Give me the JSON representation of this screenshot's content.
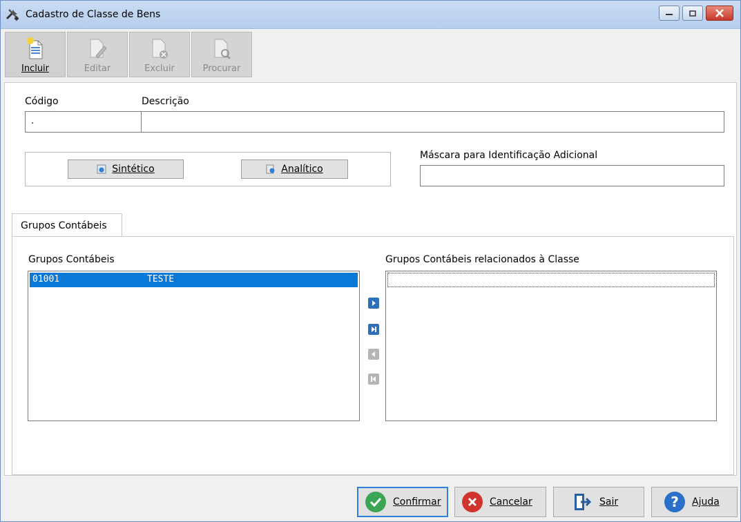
{
  "window": {
    "title": "Cadastro de Classe de Bens",
    "controls": [
      "minimize",
      "maximize",
      "close"
    ]
  },
  "toolbar": {
    "items": [
      {
        "label": "Incluir",
        "enabled": true,
        "icon": "document-new-icon"
      },
      {
        "label": "Editar",
        "enabled": false,
        "icon": "document-edit-icon"
      },
      {
        "label": "Excluir",
        "enabled": false,
        "icon": "document-delete-icon"
      },
      {
        "label": "Procurar",
        "enabled": false,
        "icon": "document-search-icon"
      }
    ]
  },
  "form": {
    "codigo_label": "Código",
    "codigo_value": ".",
    "descricao_label": "Descrição",
    "descricao_value": "",
    "sintetico_label": "Sintético",
    "analitico_label": "Analítico",
    "mascara_label": "Máscara para Identificação Adicional",
    "mascara_value": ""
  },
  "tabs": {
    "active": "Grupos Contábeis"
  },
  "groups": {
    "left_title": "Grupos Contábeis",
    "right_title": "Grupos Contábeis relacionados à Classe",
    "left_rows": [
      {
        "code": "01001",
        "name": "TESTE"
      }
    ],
    "right_rows": []
  },
  "transfer": {
    "buttons": [
      {
        "icon": "move-right-icon",
        "enabled": true
      },
      {
        "icon": "move-all-right-icon",
        "enabled": true
      },
      {
        "icon": "move-left-icon",
        "enabled": false
      },
      {
        "icon": "move-all-left-icon",
        "enabled": false
      }
    ]
  },
  "footer": {
    "confirmar": "Confirmar",
    "cancelar": "Cancelar",
    "sair": "Sair",
    "ajuda": "Ajuda"
  },
  "colors": {
    "selection": "#0a78d7",
    "confirm": "#3aa655",
    "cancel": "#d0342c",
    "help": "#2a6fc9",
    "transfer_enabled": "#2d6fb8",
    "transfer_disabled": "#b5b5b5"
  }
}
